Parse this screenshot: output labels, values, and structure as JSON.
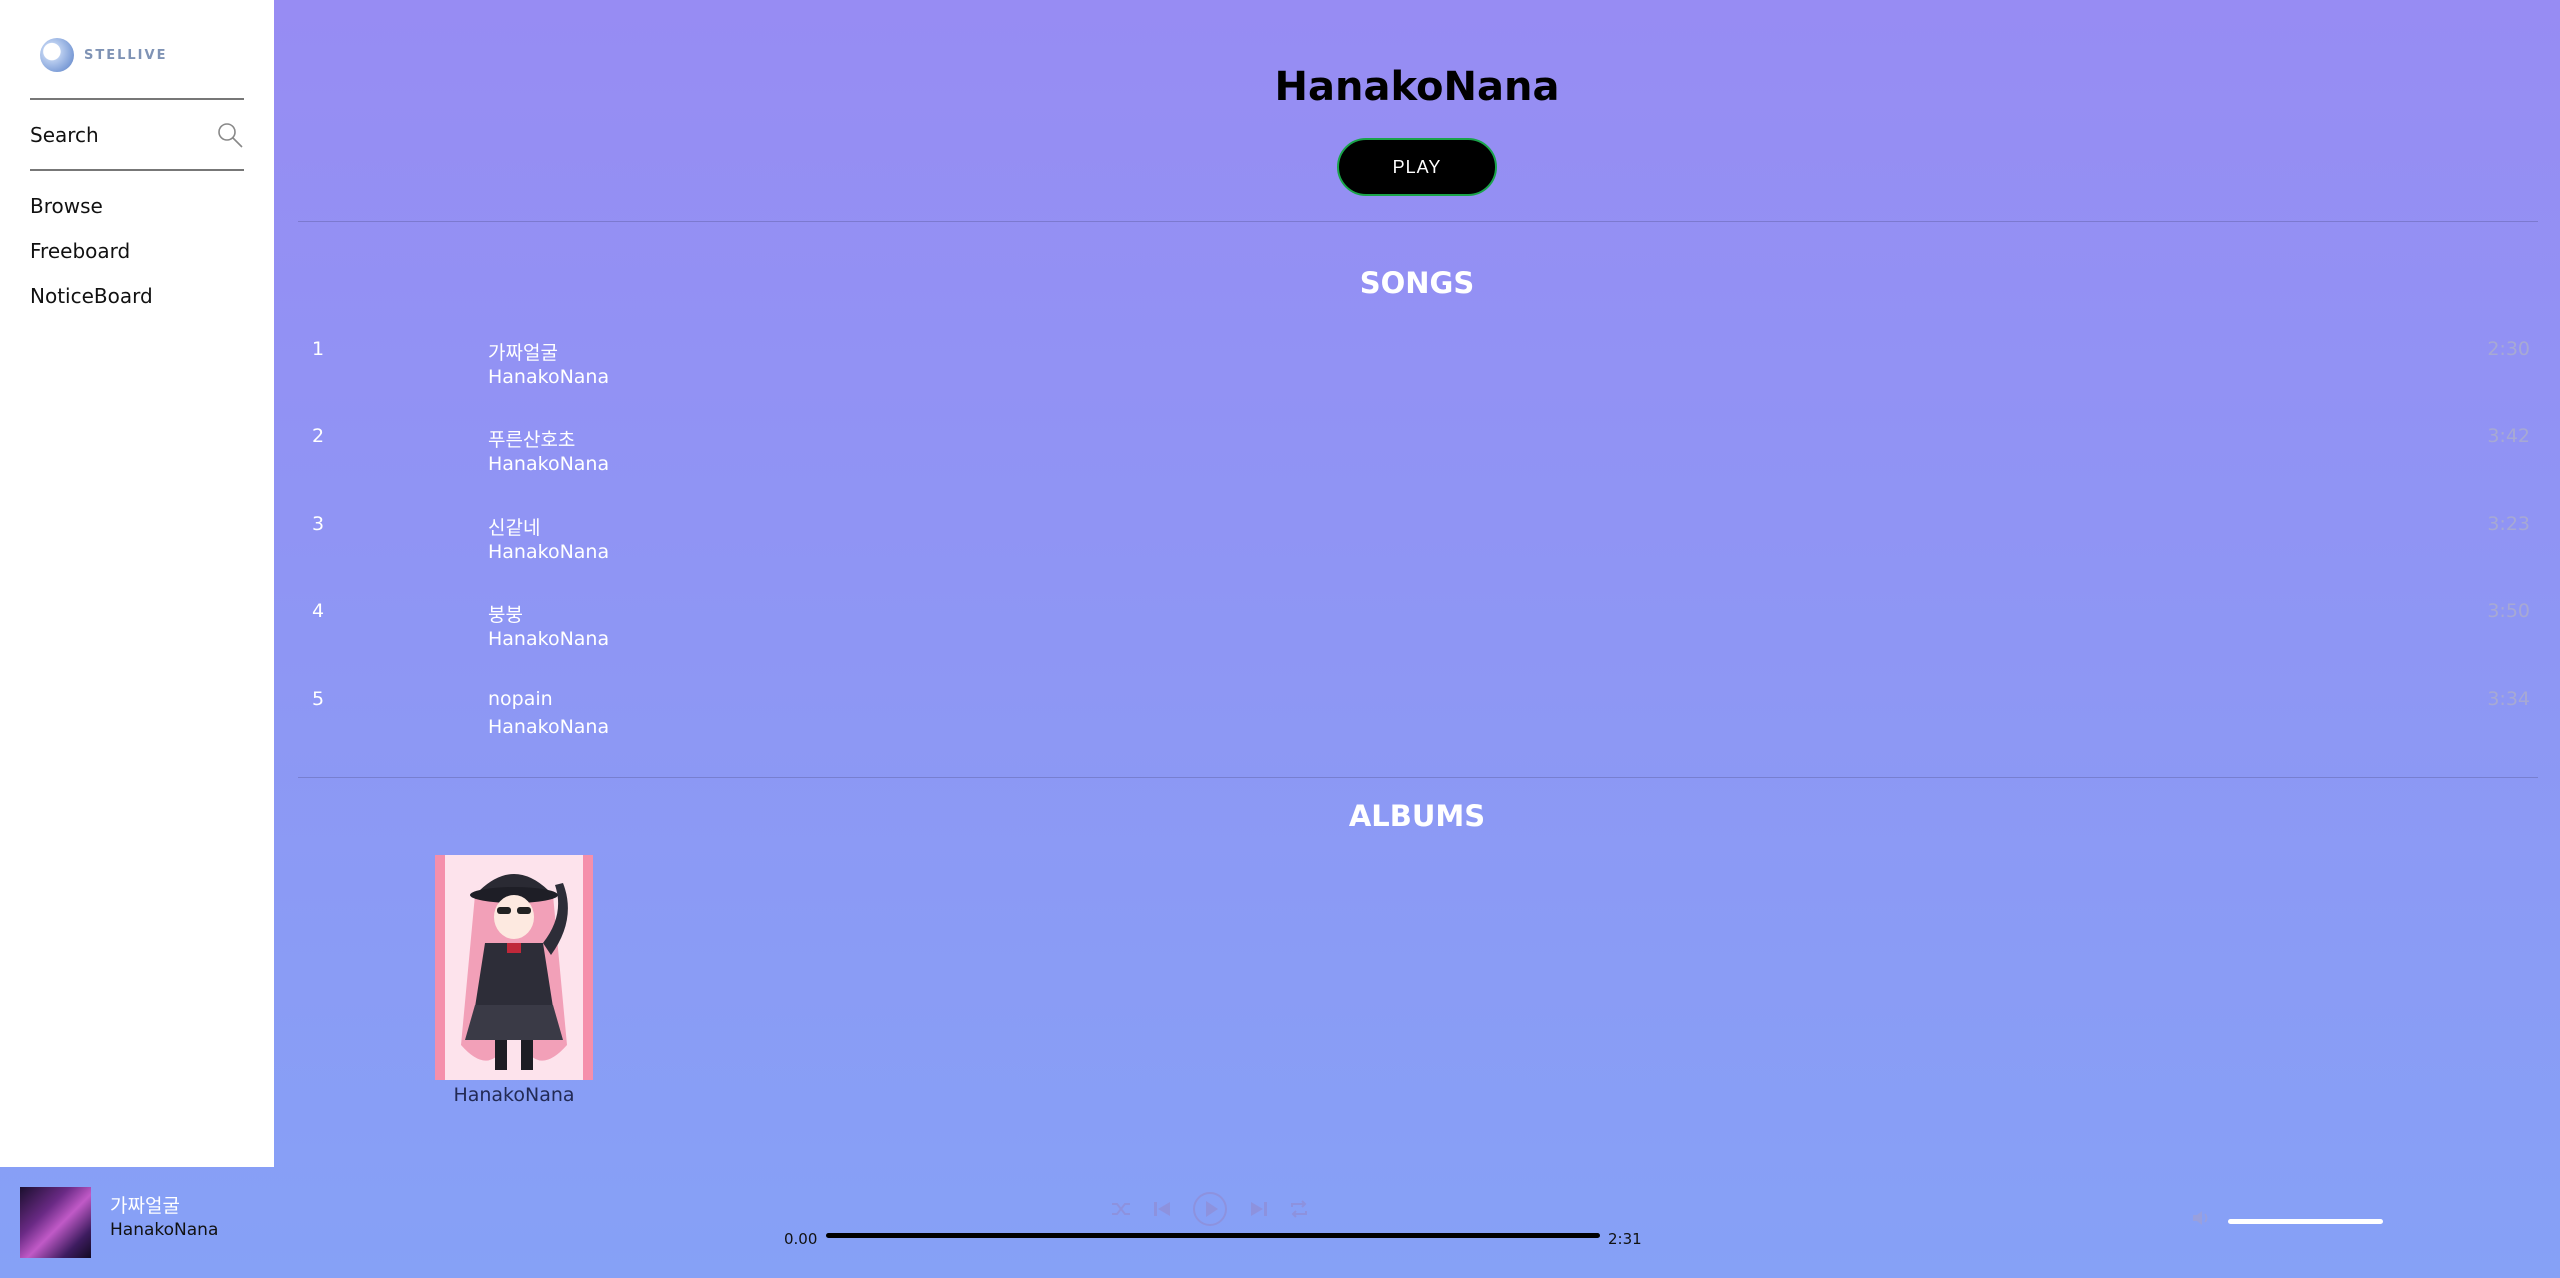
{
  "sidebar": {
    "logo_text": "STELLIVE",
    "search_label": "Search",
    "nav": [
      "Browse",
      "Freeboard",
      "NoticeBoard"
    ]
  },
  "artist": {
    "name": "HanakoNana",
    "play_label": "PLAY"
  },
  "songs_section": {
    "title": "SONGS",
    "items": [
      {
        "num": "1",
        "title": "가짜얼굴",
        "artist": "HanakoNana",
        "duration": "2:30"
      },
      {
        "num": "2",
        "title": "푸른산호초",
        "artist": "HanakoNana",
        "duration": "3:42"
      },
      {
        "num": "3",
        "title": "신같네",
        "artist": "HanakoNana",
        "duration": "3:23"
      },
      {
        "num": "4",
        "title": "붕붕",
        "artist": "HanakoNana",
        "duration": "3:50"
      },
      {
        "num": "5",
        "title": "nopain",
        "artist": "HanakoNana",
        "duration": "3:34"
      }
    ]
  },
  "albums_section": {
    "title": "ALBUMS",
    "items": [
      {
        "name": "HanakoNana"
      }
    ]
  },
  "player": {
    "now_playing_title": "가짜얼굴",
    "now_playing_artist": "HanakoNana",
    "current_time": "0.00",
    "total_time": "2:31",
    "controls": [
      "shuffle-icon",
      "previous-icon",
      "play-icon",
      "next-icon",
      "repeat-icon"
    ]
  },
  "colors": {
    "accent_border": "#1aa34a",
    "background_top": "#978cf3",
    "background_bottom": "#86a1f6"
  }
}
